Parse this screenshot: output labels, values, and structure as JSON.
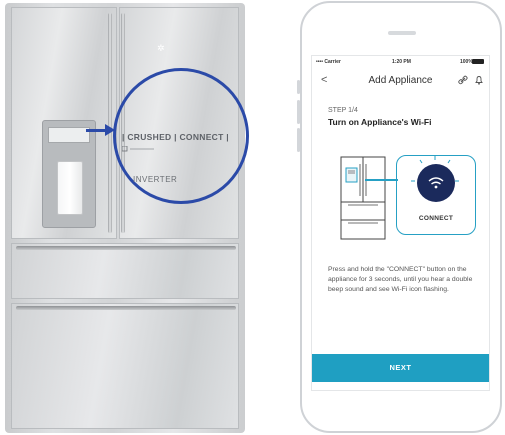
{
  "fridge": {
    "panel_text": "| CRUSHED | CONNECT |",
    "inverter_label": "INVERTER"
  },
  "phone": {
    "status": {
      "carrier": "•••• Carrier",
      "time": "1:20 PM",
      "battery": "100%"
    },
    "nav": {
      "back": "<",
      "title": "Add Appliance"
    },
    "step": "STEP 1/4",
    "heading": "Turn on Appliance's Wi-Fi",
    "connect_label": "CONNECT",
    "instructions": "Press and hold the \"CONNECT\" button on the appliance for 3 seconds, until you hear a double beep sound and see Wi-Fi icon flashing.",
    "next_button": "NEXT"
  },
  "colors": {
    "accent": "#1f9fc2",
    "connect_circle": "#1b2a5c",
    "magnifier": "#2b4aa8"
  },
  "icons": [
    "wifi-icon",
    "link-icon",
    "bell-icon",
    "chevron-left-icon"
  ]
}
